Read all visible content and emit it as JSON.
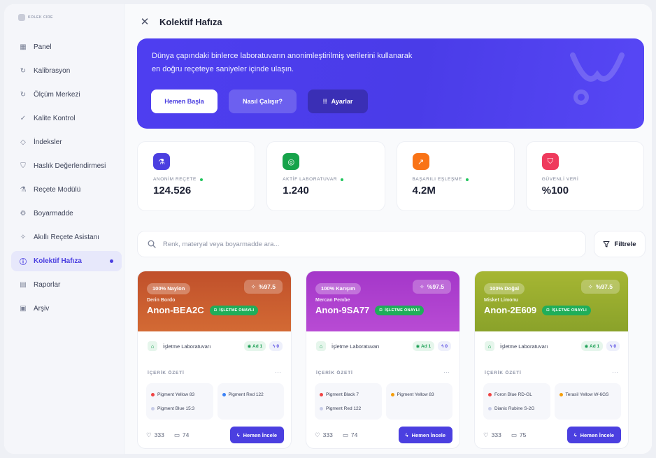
{
  "sidebar": {
    "logo_text": "KOLEK CIRE",
    "items": [
      {
        "label": "Panel",
        "icon": "grid-icon"
      },
      {
        "label": "Kalibrasyon",
        "icon": "refresh-icon"
      },
      {
        "label": "Ölçüm Merkezi",
        "icon": "refresh-icon"
      },
      {
        "label": "Kalite Kontrol",
        "icon": "check-spark-icon"
      },
      {
        "label": "İndeksler",
        "icon": "index-icon"
      },
      {
        "label": "Haslık Değerlendirmesi",
        "icon": "shield-icon"
      },
      {
        "label": "Reçete Modülü",
        "icon": "flask-icon"
      },
      {
        "label": "Boyarmadde",
        "icon": "gear-icon"
      },
      {
        "label": "Akıllı Reçete Asistanı",
        "icon": "sparkle-icon"
      },
      {
        "label": "Kolektif Hafıza",
        "icon": "info-icon",
        "active": true
      },
      {
        "label": "Raporlar",
        "icon": "report-icon"
      },
      {
        "label": "Arşiv",
        "icon": "archive-icon"
      }
    ]
  },
  "header": {
    "title": "Kolektif Hafıza"
  },
  "hero": {
    "line1": "Dünya çapındaki binlerce laboratuvarın anonimleştirilmiş verilerini kullanarak",
    "line2": "en doğru reçeteye saniyeler içinde ulaşın.",
    "btn_start": "Hemen Başla",
    "btn_how": "Nasıl Çalışır?",
    "btn_settings": "Ayarlar"
  },
  "stats": [
    {
      "label": "ANONİM REÇETE",
      "value": "124.526",
      "color": "#4b3fe0"
    },
    {
      "label": "AKTİF LABORATUVAR",
      "value": "1.240",
      "color": "#16a34a"
    },
    {
      "label": "BAŞARILI EŞLEŞME",
      "value": "4.2M",
      "color": "#f97316"
    },
    {
      "label": "GÜVENLİ VERİ",
      "value": "%100",
      "color": "#ef3a5d"
    }
  ],
  "search": {
    "placeholder": "Renk, materyal veya boyarmadde ara..."
  },
  "filter_label": "Filtrele",
  "cards": [
    {
      "material": "100% Naylon",
      "match": "%97.5",
      "sub": "Derin Bordo",
      "name": "Anon-BEA2C",
      "verified": "İŞLETME ONAYLI",
      "lab": "İşletme Laboratuvarı",
      "ad": "Ad 1",
      "n": "0",
      "section": "İÇERİK ÖZETİ",
      "pigments_a": [
        {
          "name": "Pigment Yellow 83",
          "color": "#ef4444"
        },
        {
          "name": "Pigment Blue 15:3",
          "color": "#c7cce8"
        }
      ],
      "pigments_b": [
        {
          "name": "Pigment Red 122",
          "color": "#3b82f6"
        }
      ],
      "likes": "333",
      "comments": "74",
      "cta": "Hemen İncele"
    },
    {
      "material": "100% Karışım",
      "match": "%97.5",
      "sub": "Mercan Pembe",
      "name": "Anon-9SA77",
      "verified": "İŞLETME ONAYLI",
      "lab": "İşletme Laboratuvarı",
      "ad": "Ad 1",
      "n": "0",
      "section": "İÇERİK ÖZETİ",
      "pigments_a": [
        {
          "name": "Pigment Black 7",
          "color": "#ef4444"
        },
        {
          "name": "Pigment Red 122",
          "color": "#c7cce8"
        }
      ],
      "pigments_b": [
        {
          "name": "Pigment Yellow 83",
          "color": "#f59e0b"
        }
      ],
      "likes": "333",
      "comments": "74",
      "cta": "Hemen İncele"
    },
    {
      "material": "100% Doğal",
      "match": "%97.5",
      "sub": "Misket Limonu",
      "name": "Anon-2E609",
      "verified": "İŞLETME ONAYLI",
      "lab": "İşletme Laboratuvarı",
      "ad": "Ad 1",
      "n": "0",
      "section": "İÇERİK ÖZETİ",
      "pigments_a": [
        {
          "name": "Foron Blue RD-GL",
          "color": "#ef4444"
        },
        {
          "name": "Dianix Rubine S-2G",
          "color": "#c7cce8"
        }
      ],
      "pigments_b": [
        {
          "name": "Terasil Yellow W-6GS",
          "color": "#f59e0b"
        }
      ],
      "likes": "333",
      "comments": "75",
      "cta": "Hemen İncele"
    }
  ]
}
